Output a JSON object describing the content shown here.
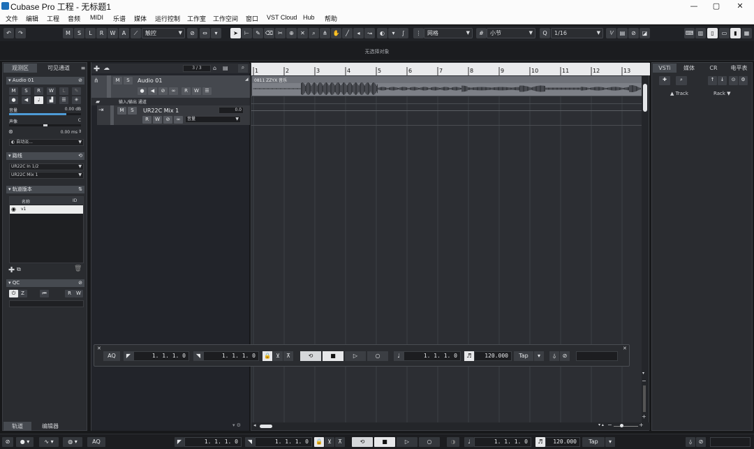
{
  "window": {
    "title": "Cubase Pro 工程 - 无标题1",
    "controls": {
      "minimize": "—",
      "maximize": "▢",
      "close": "✕"
    }
  },
  "menu": [
    "文件",
    "编辑",
    "工程",
    "音频",
    "MIDI",
    "乐谱",
    "媒体",
    "运行控制",
    "工作室",
    "工作空间",
    "窗口",
    "VST Cloud",
    "Hub",
    "帮助"
  ],
  "toolbar": {
    "state_buttons": [
      "M",
      "S",
      "L",
      "R",
      "W",
      "A"
    ],
    "automation_mode": "触控",
    "snap_type": "网格",
    "grid_type": "小节",
    "quantize": "1/16"
  },
  "info_line": {
    "text": "无选择对象"
  },
  "inspector": {
    "tabs": [
      "观测区",
      "可见通道"
    ],
    "track_section": {
      "name": "Audio 01",
      "buttons": [
        "M",
        "S",
        "R",
        "W",
        "L",
        "✎"
      ]
    },
    "volume": {
      "label": "音量",
      "value": "0.00 dB",
      "level": 0.8
    },
    "pan": {
      "label": "声像",
      "value": "C",
      "level": 0.5
    },
    "delay": {
      "value": "0.00 ms"
    },
    "auto_fade": "自动淡...",
    "routing": {
      "label": "路线",
      "input": "UR22C In 1/2",
      "output": "UR22C Mix 1"
    },
    "track_versions": {
      "label": "轨道版本",
      "col_name": "名称",
      "col_id": "ID",
      "rows": [
        "v1"
      ]
    },
    "qc": {
      "label": "QC",
      "buttons": [
        "R",
        "W"
      ]
    },
    "bottom_tabs": [
      "轨道",
      "编辑器"
    ]
  },
  "track_list": {
    "counter": "3 / 3",
    "tracks": [
      {
        "name": "Audio 01",
        "buttons": [
          "M",
          "S"
        ],
        "sub_buttons": [
          "R",
          "W"
        ]
      },
      {
        "folder_label": "输入/输出 通道"
      },
      {
        "name": "UR22C Mix 1",
        "buttons": [
          "M",
          "S"
        ],
        "sub_buttons": [
          "R",
          "W"
        ],
        "value": "0.0",
        "param": "音量"
      }
    ]
  },
  "ruler": {
    "bars": [
      "1",
      "2",
      "3",
      "4",
      "5",
      "6",
      "7",
      "8",
      "9",
      "10",
      "11",
      "12",
      "13"
    ]
  },
  "audio_event": {
    "name": "0811 ZZYX 音乐",
    "color": "#7d8087"
  },
  "right_zone": {
    "tabs": [
      "VSTi",
      "媒体",
      "CR",
      "电平表"
    ],
    "track_label": "Track",
    "rack_label": "Rack"
  },
  "transport": {
    "aq": "AQ",
    "left_locator": "1. 1. 1.   0",
    "right_locator": "1. 1. 1.   0",
    "position": "1. 1. 1.   0",
    "tempo": "120.000",
    "tap": "Tap"
  },
  "status_bar": {
    "aq": "AQ",
    "left_locator": "1. 1. 1.   0",
    "right_locator": "1. 1. 1.   0",
    "position": "1. 1. 1.   0",
    "tempo": "120.000",
    "tap": "Tap"
  }
}
